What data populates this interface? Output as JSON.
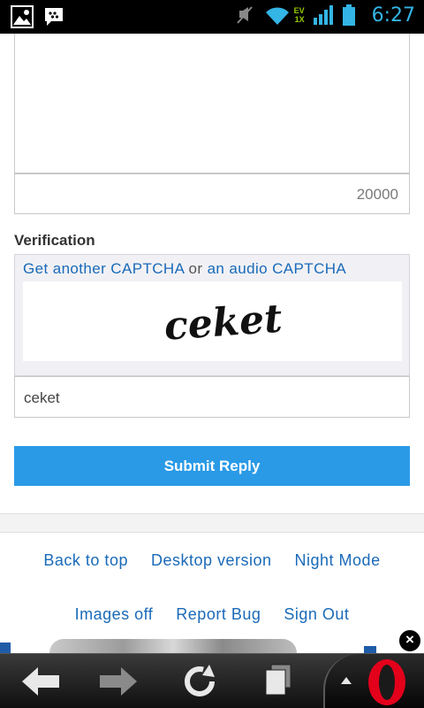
{
  "status_bar": {
    "time": "6:27",
    "network_label_top": "EV",
    "network_label_bottom": "1X",
    "signal_label": "5"
  },
  "form": {
    "char_counter": "20000",
    "verification_label": "Verification",
    "captcha_link_another": "Get another CAPTCHA",
    "captcha_link_separator": " or ",
    "captcha_link_audio": "an audio CAPTCHA",
    "captcha_image_text": "ceket",
    "answer_value": "ceket",
    "submit_label": "Submit Reply"
  },
  "footer": {
    "row1": [
      "Back to top",
      "Desktop version",
      "Night Mode"
    ],
    "row2": [
      "Images off",
      "Report Bug",
      "Sign Out"
    ]
  },
  "ad": {
    "close_label": "×"
  },
  "colors": {
    "link": "#1a6ab8",
    "submit_bg": "#2a9ae6",
    "status_accent": "#33b5e5",
    "opera_red": "#e3001b"
  }
}
